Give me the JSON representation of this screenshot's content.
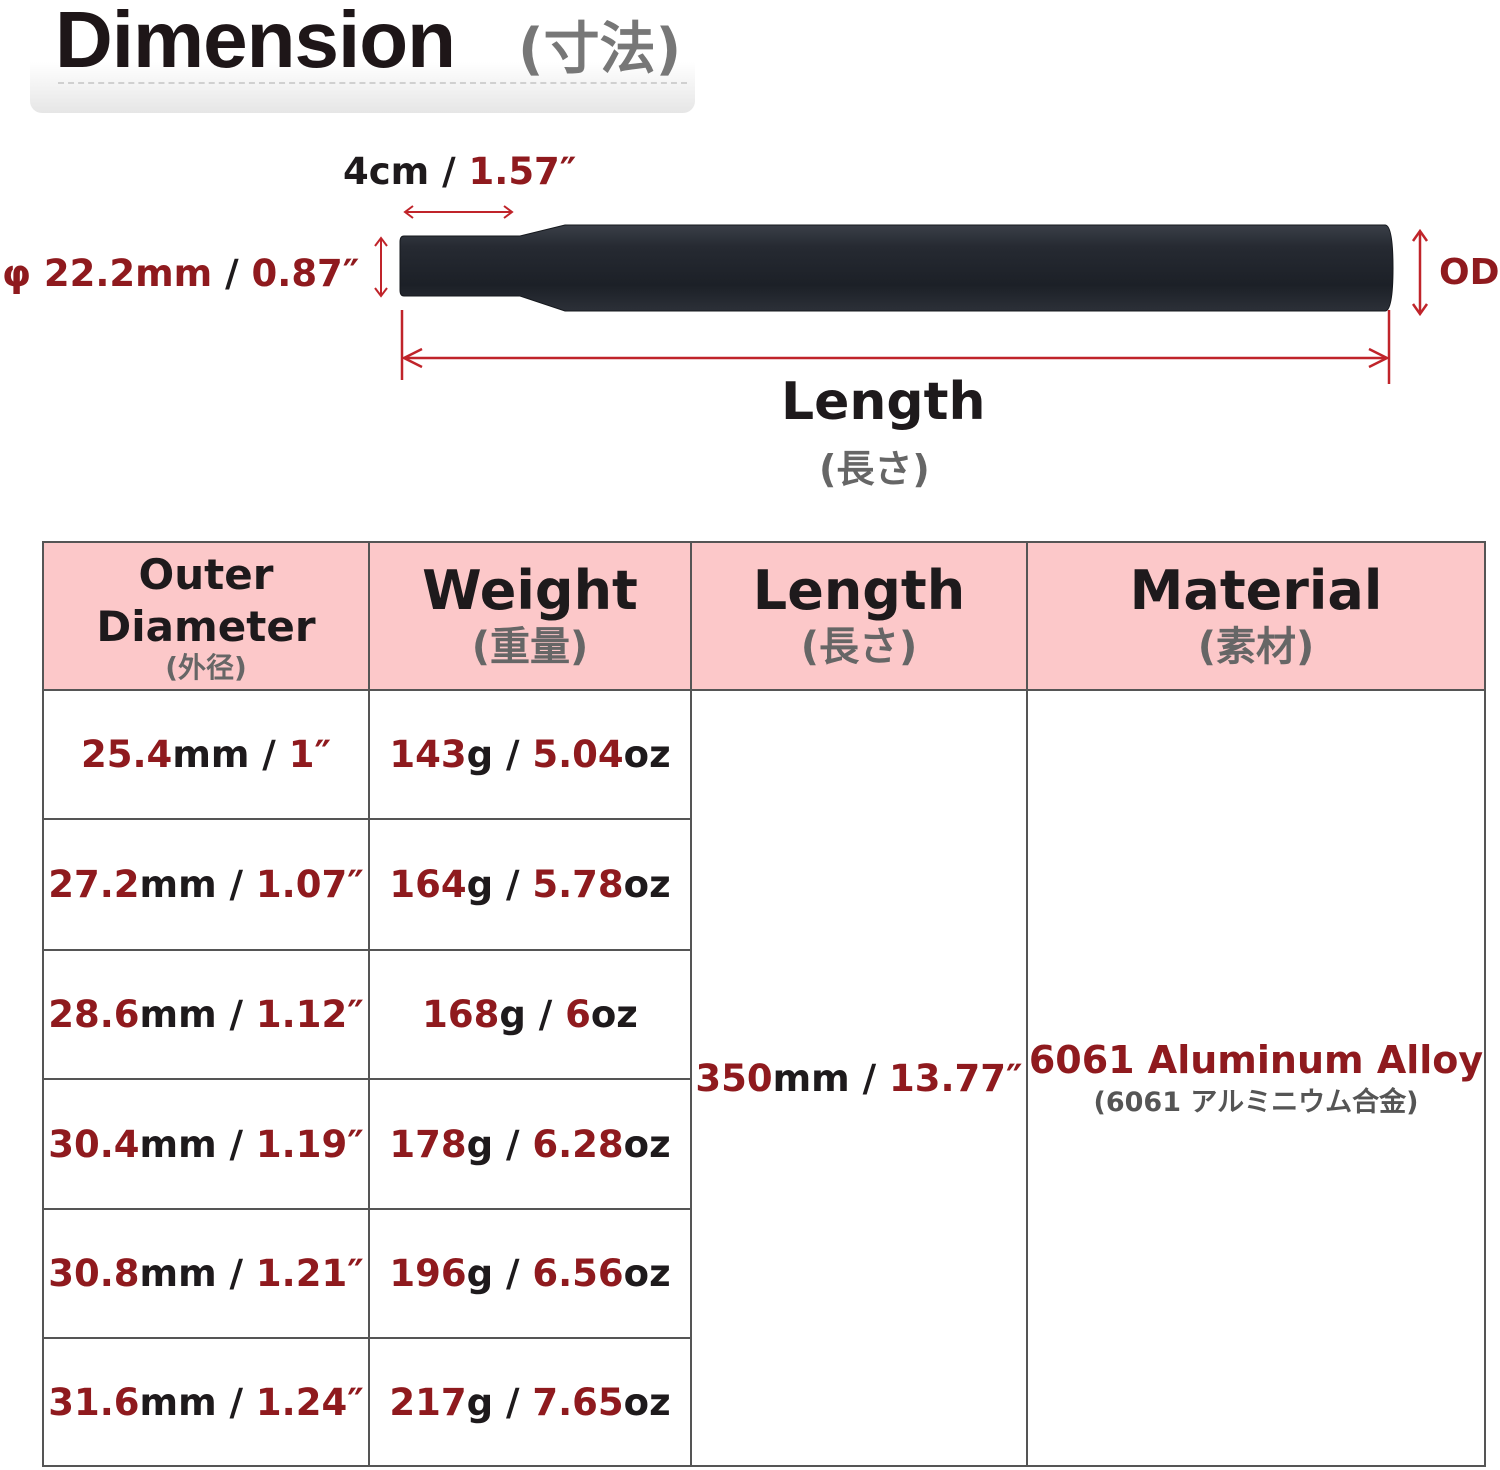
{
  "title": {
    "main": "Dimension",
    "sub": "(寸法)"
  },
  "diagram": {
    "taper_length": {
      "cm": "4cm",
      "sep": " / ",
      "inch": "1.57″"
    },
    "tip_diameter": {
      "mm": "φ 22.2mm",
      "sep": " / ",
      "inch": "0.87″"
    },
    "od_label": "OD",
    "length_label": "Length",
    "length_sub": "(長さ)",
    "colors": {
      "accent": "#8f1a1e",
      "tube": "#20242c",
      "arrow": "#c0242a"
    }
  },
  "table": {
    "headers": {
      "outer_diameter": {
        "line1": "Outer",
        "line2": "Diameter",
        "sub": "(外径)"
      },
      "weight": {
        "main": "Weight",
        "sub": "(重量)"
      },
      "length": {
        "main": "Length",
        "sub": "(長さ)"
      },
      "material": {
        "main": "Material",
        "sub": "(素材)"
      }
    },
    "rows": [
      {
        "od_mm": "25.4",
        "od_mm_unit": "mm",
        "od_in": "1″",
        "w_g": "143",
        "w_g_unit": "g",
        "w_oz": "5.04",
        "w_oz_unit": "oz"
      },
      {
        "od_mm": "27.2",
        "od_mm_unit": "mm",
        "od_in": "1.07″",
        "w_g": "164",
        "w_g_unit": "g",
        "w_oz": "5.78",
        "w_oz_unit": "oz"
      },
      {
        "od_mm": "28.6",
        "od_mm_unit": "mm",
        "od_in": "1.12″",
        "w_g": "168",
        "w_g_unit": "g",
        "w_oz": "6",
        "w_oz_unit": "oz"
      },
      {
        "od_mm": "30.4",
        "od_mm_unit": "mm",
        "od_in": "1.19″",
        "w_g": "178",
        "w_g_unit": "g",
        "w_oz": "6.28",
        "w_oz_unit": "oz"
      },
      {
        "od_mm": "30.8",
        "od_mm_unit": "mm",
        "od_in": "1.21″",
        "w_g": "196",
        "w_g_unit": "g",
        "w_oz": "6.56",
        "w_oz_unit": "oz"
      },
      {
        "od_mm": "31.6",
        "od_mm_unit": "mm",
        "od_in": "1.24″",
        "w_g": "217",
        "w_g_unit": "g",
        "w_oz": "7.65",
        "w_oz_unit": "oz"
      }
    ],
    "separator": " / ",
    "length": {
      "mm": "350",
      "mm_unit": "mm",
      "inch": "13.77″"
    },
    "material": {
      "main": "6061 Aluminum Alloy",
      "sub": "(6061 アルミニウム合金)"
    }
  }
}
